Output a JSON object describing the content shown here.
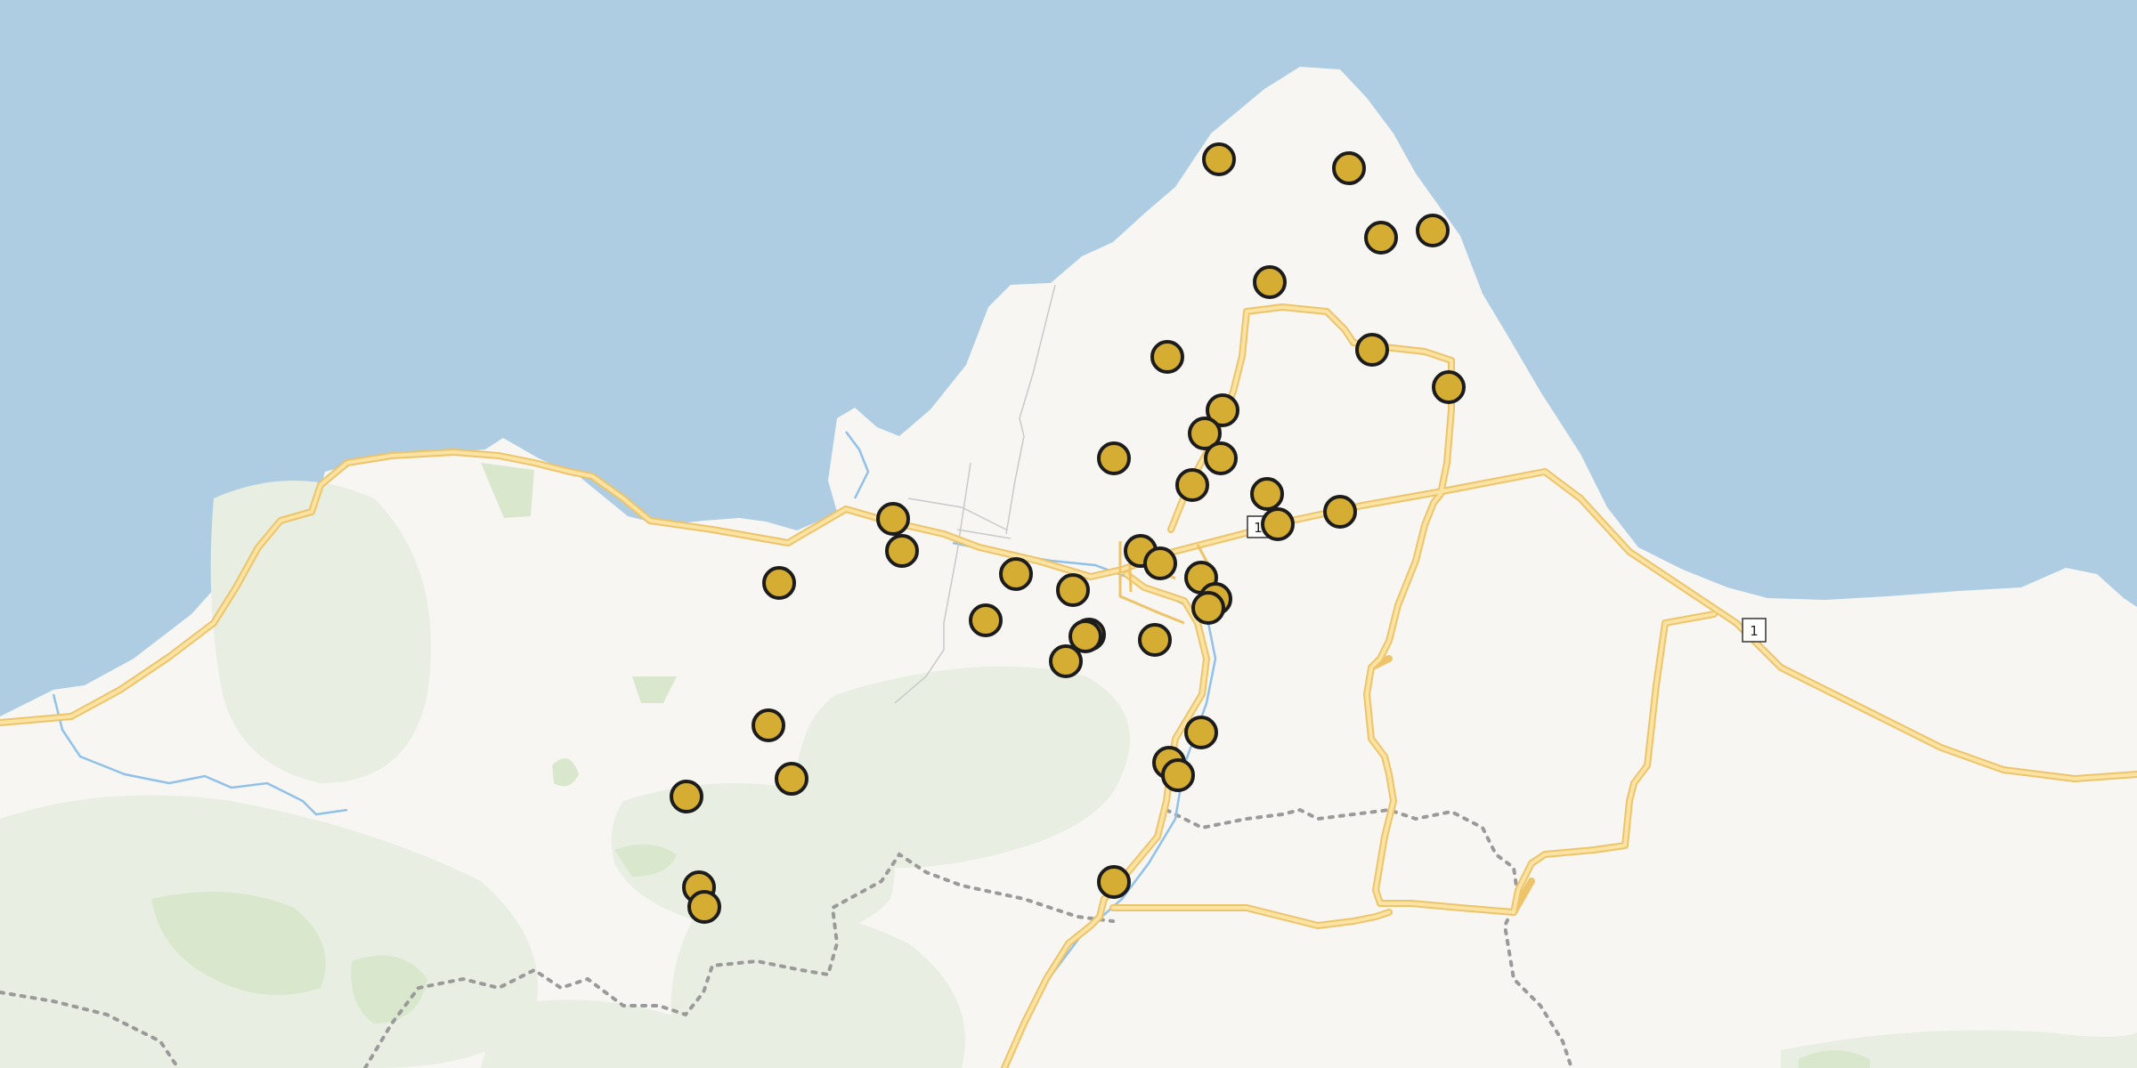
{
  "map": {
    "colors": {
      "water": "#aecde3",
      "land": "#f8f6f3",
      "forest": "#e8eee2",
      "forest_dark": "#d9e7cd",
      "road_fill": "#fbe3a3",
      "road_casing": "#edc46a",
      "minor_road": "#c9c9c9",
      "river": "#8fc1ea",
      "boundary": "#9a9a9a",
      "marker_fill": "#d4ad32",
      "marker_stroke": "#1c1c1c"
    },
    "route_shields": [
      {
        "label": "1"
      },
      {
        "label": "1"
      }
    ],
    "markers": [
      {
        "name": "poi-marker"
      }
    ]
  }
}
